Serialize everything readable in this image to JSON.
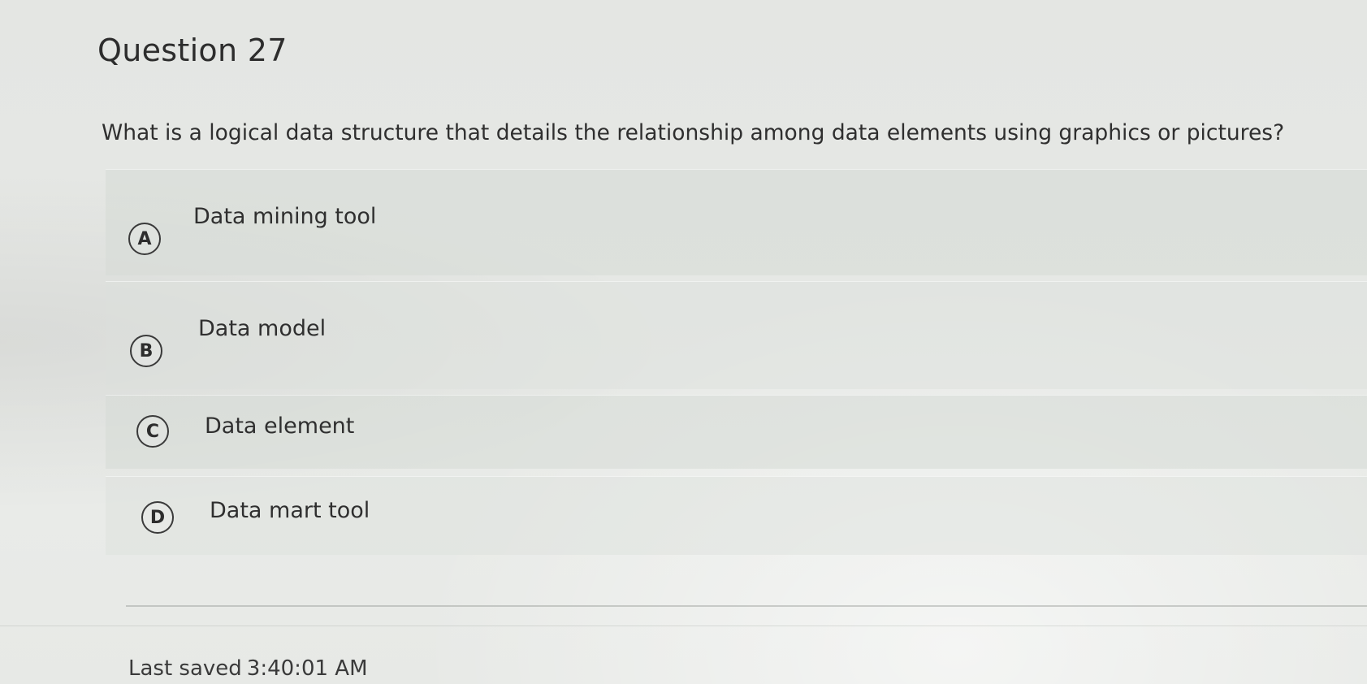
{
  "question": {
    "title": "Question 27",
    "text": "What is a logical data structure that details the relationship among data elements using graphics or pictures?"
  },
  "options": [
    {
      "letter": "A",
      "label": "Data mining tool"
    },
    {
      "letter": "B",
      "label": "Data model"
    },
    {
      "letter": "C",
      "label": "Data element"
    },
    {
      "letter": "D",
      "label": "Data mart tool"
    }
  ],
  "status": {
    "last_saved_label": "Last saved",
    "last_saved_time": "3:40:01 AM"
  }
}
